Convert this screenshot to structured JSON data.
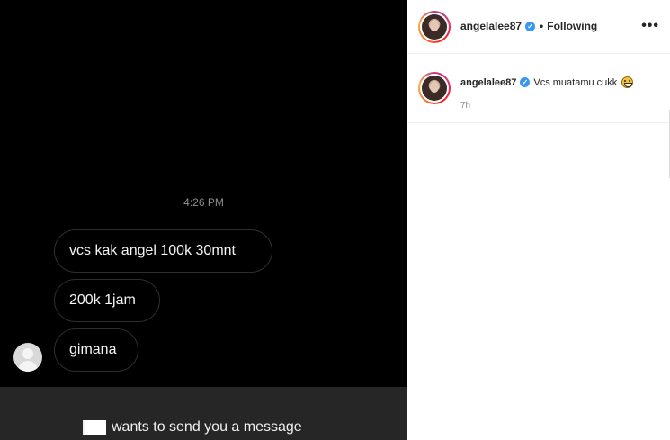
{
  "dm": {
    "timestamp": "4:26 PM",
    "messages": [
      {
        "text": "vcs kak angel 100k 30mnt"
      },
      {
        "text": "200k 1jam"
      },
      {
        "text": "gimana"
      }
    ],
    "request_text": "wants to send you a message"
  },
  "post": {
    "header": {
      "username": "angelalee87",
      "separator": "•",
      "follow_status": "Following",
      "more_icon": "ellipsis-icon"
    },
    "comment": {
      "username": "angelalee87",
      "text": "Vcs muatamu cukk",
      "emoji": "grinning-face-emoji",
      "time": "7h"
    }
  },
  "colors": {
    "dm_background": "#000000",
    "bubble_border": "#2e2e2e",
    "footer_background": "#262626",
    "verified_blue": "#3897f0",
    "muted_text": "#8e8e8e"
  }
}
